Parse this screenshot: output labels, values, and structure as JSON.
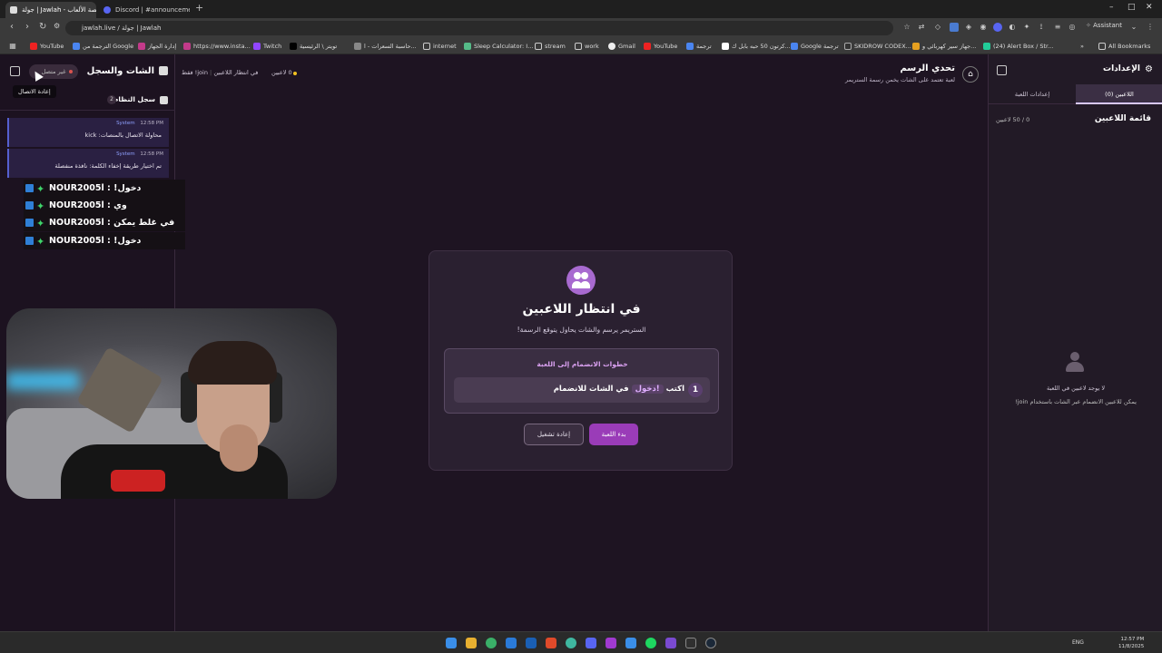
{
  "browser": {
    "tabs": [
      {
        "title": "جولة | Jawlah - منصة الألعاب",
        "active": true
      },
      {
        "title": "Discord | #announcement | Ja",
        "active": false
      }
    ],
    "url": "jawlah.live / جولة | Jawlah",
    "assistant_label": "Assistant",
    "bookmarks": [
      "YouTube",
      "الترجمة من Google",
      "إدارة الجهاز",
      "https://www.insta...",
      "Twitch",
      "تويتر \\ الرئيسية",
      "حاسبة السعرات - ا...",
      "internet",
      "Sleep Calculator: I...",
      "stream",
      "work",
      "Gmail",
      "YouTube",
      "ترجمة",
      "كرتون 50 حبه بابل ك...",
      "Google ترجمة",
      "SKIDROW CODEX...",
      "جهاز سير كهربائي و...",
      "(24) Alert Box / Str...",
      "All Bookmarks"
    ]
  },
  "chat_panel": {
    "title": "الشات والسجل",
    "connection_status": "غير متصل",
    "tooltip": "إعادة الاتصال",
    "system_log_label": "سجل النظام",
    "system_log_count": "2",
    "system_messages": [
      {
        "sender": "System",
        "time": "12:58 PM",
        "text": "محاولة الاتصال بالمنصات: kick"
      },
      {
        "sender": "System",
        "time": "12:58 PM",
        "text": "تم اختيار طريقة إخفاء الكلمة: نافذة منفصلة"
      }
    ],
    "chat_lines": [
      "NOUR2005l : !دخول",
      "NOUR2005l : وي",
      "NOUR2005l : في غلط يمكن",
      "NOUR2005l : !دخول"
    ]
  },
  "header": {
    "players_count": "0 لاعبين",
    "status": "في انتظار اللاعبين",
    "join_hint": "join! فقط",
    "game_title": "تحدي الرسم",
    "game_subtitle": "لعبة تعتمد على الشات يخمن رسمة الستريمر"
  },
  "card": {
    "title": "في انتظار اللاعبين",
    "subtitle": "الستريمر يرسم والشات يحاول يتوقع الرسمة!",
    "steps_title": "خطوات الانضمام إلى اللعبة",
    "step_number": "1",
    "step_prefix": "اكتب",
    "step_code": "!دخول",
    "step_suffix": "في الشات للانضمام",
    "restart_label": "إعادة تشغيل",
    "start_label": "بدء اللعبة"
  },
  "settings": {
    "title": "الإعدادات",
    "tab_players": "اللاعبين (0)",
    "tab_game_settings": "إعدادات اللعبة",
    "player_list_title": "قائمة اللاعبين",
    "player_count": "0 / 50 لاعبين",
    "empty_title": "لا يوجد لاعبين في اللعبة",
    "empty_subtitle": "يمكن للاعبين الانضمام عبر الشات باستخدام join!"
  },
  "taskbar": {
    "language": "ENG",
    "time": "12:57 PM",
    "date": "11/8/2025"
  }
}
